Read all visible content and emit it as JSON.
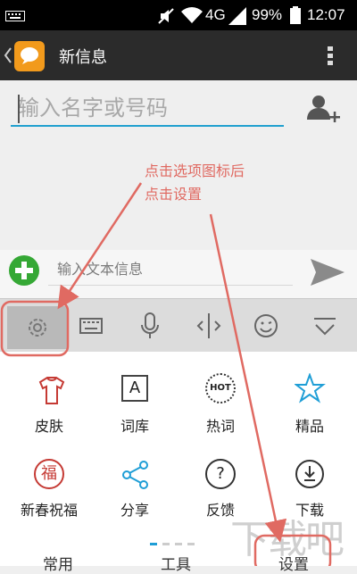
{
  "status_bar": {
    "network": "4G",
    "battery": "99%",
    "time": "12:07"
  },
  "action_bar": {
    "title": "新信息"
  },
  "recipient": {
    "placeholder": "输入名字或号码"
  },
  "annotation": {
    "line1": "点击选项图标后",
    "line2": "点击设置"
  },
  "compose": {
    "placeholder": "输入文本信息"
  },
  "keyboard_toolbar": {
    "icons": [
      "gear-icon",
      "keyboard-icon",
      "microphone-icon",
      "cursor-icon",
      "emoji-icon",
      "collapse-icon"
    ]
  },
  "panel": {
    "items": [
      {
        "label": "皮肤",
        "icon": "shirt-icon"
      },
      {
        "label": "词库",
        "icon": "dictionary-icon"
      },
      {
        "label": "热词",
        "icon": "hot-icon",
        "icon_text": "HOT"
      },
      {
        "label": "精品",
        "icon": "star-icon"
      },
      {
        "label": "新春祝福",
        "icon": "blessing-icon",
        "icon_text": "福"
      },
      {
        "label": "分享",
        "icon": "share-icon"
      },
      {
        "label": "反馈",
        "icon": "question-icon",
        "icon_text": "?"
      },
      {
        "label": "下载",
        "icon": "download-icon"
      }
    ],
    "bottom_tabs": [
      "常用",
      "工具",
      "设置"
    ],
    "dictionary_icon_text": "A"
  },
  "watermark": "下载吧",
  "colors": {
    "accent_blue": "#21a0cf",
    "annotation_red": "#e06a62",
    "green_add": "#35a835",
    "status_bg": "#000000",
    "action_bar_bg": "#2b2b2b"
  }
}
